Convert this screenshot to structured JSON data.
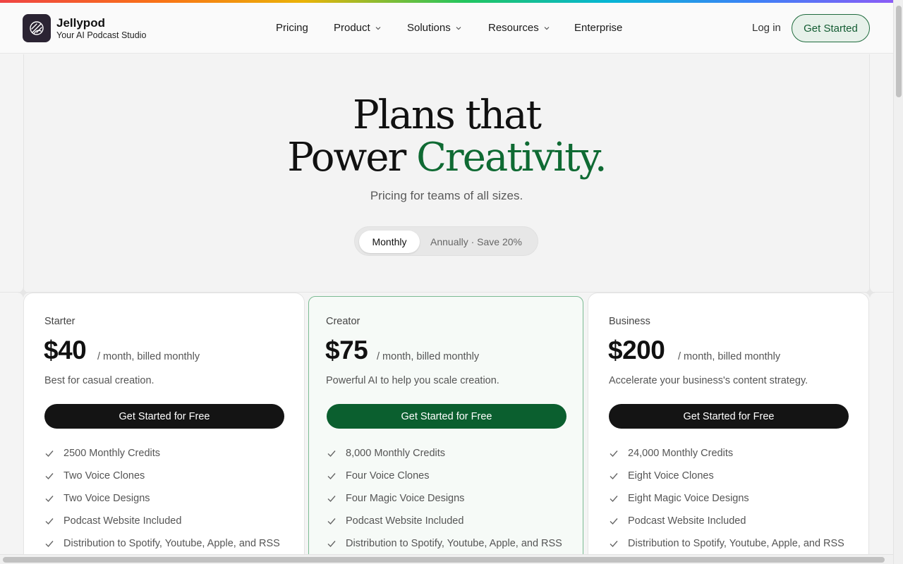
{
  "brand": {
    "name": "Jellypod",
    "tagline": "Your AI Podcast Studio"
  },
  "nav": {
    "pricing": "Pricing",
    "product": "Product",
    "solutions": "Solutions",
    "resources": "Resources",
    "enterprise": "Enterprise",
    "login": "Log in",
    "get_started": "Get Started"
  },
  "hero": {
    "title_line1": "Plans that",
    "title_line2_plain": "Power",
    "title_line2_accent": "Creativity.",
    "subtitle": "Pricing for teams of all sizes."
  },
  "billing_toggle": {
    "monthly": "Monthly",
    "annually": "Annually · Save 20%",
    "selected": "Monthly"
  },
  "plans": [
    {
      "name": "Starter",
      "price": "$40",
      "period": "/ month, billed monthly",
      "description": "Best for casual creation.",
      "button": "Get Started for Free",
      "features": [
        "2500 Monthly Credits",
        "Two Voice Clones",
        "Two Voice Designs",
        "Podcast Website Included",
        "Distribution to Spotify, Youtube, Apple, and RSS"
      ]
    },
    {
      "name": "Creator",
      "price": "$75",
      "period": "/ month, billed monthly",
      "description": "Powerful AI to help you scale creation.",
      "button": "Get Started for Free",
      "features": [
        "8,000 Monthly Credits",
        "Four Voice Clones",
        "Four Magic Voice Designs",
        "Podcast Website Included",
        "Distribution to Spotify, Youtube, Apple, and RSS"
      ]
    },
    {
      "name": "Business",
      "price": "$200",
      "period": "/ month, billed monthly",
      "description": "Accelerate your business's content strategy.",
      "button": "Get Started for Free",
      "features": [
        "24,000 Monthly Credits",
        "Eight Voice Clones",
        "Eight Magic Voice Designs",
        "Podcast Website Included",
        "Distribution to Spotify, Youtube, Apple, and RSS"
      ]
    }
  ],
  "colors": {
    "accent": "#0f6a33",
    "cta_bg": "#e7f1ea",
    "dark_button": "#141414",
    "featured_button": "#0b5f2f"
  }
}
